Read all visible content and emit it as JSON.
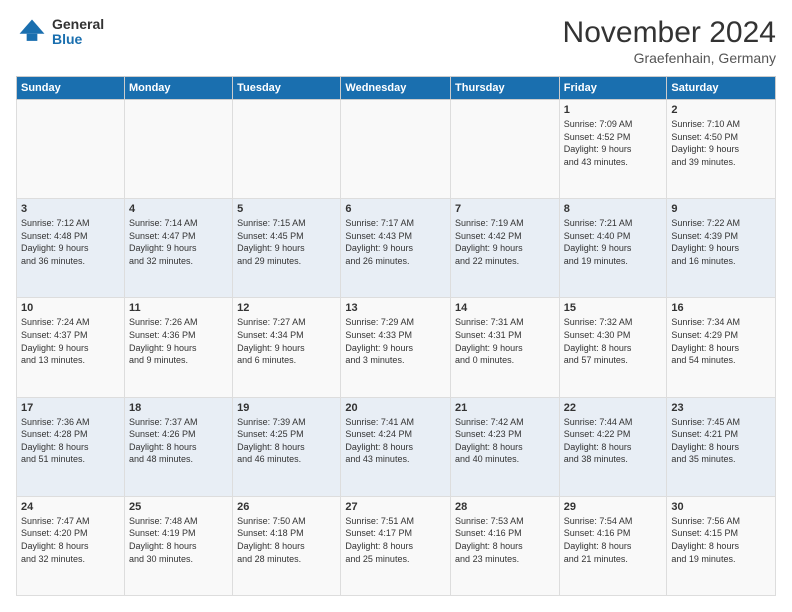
{
  "logo": {
    "general": "General",
    "blue": "Blue"
  },
  "title": "November 2024",
  "location": "Graefenhain, Germany",
  "days_of_week": [
    "Sunday",
    "Monday",
    "Tuesday",
    "Wednesday",
    "Thursday",
    "Friday",
    "Saturday"
  ],
  "weeks": [
    [
      {
        "day": "",
        "info": ""
      },
      {
        "day": "",
        "info": ""
      },
      {
        "day": "",
        "info": ""
      },
      {
        "day": "",
        "info": ""
      },
      {
        "day": "",
        "info": ""
      },
      {
        "day": "1",
        "info": "Sunrise: 7:09 AM\nSunset: 4:52 PM\nDaylight: 9 hours\nand 43 minutes."
      },
      {
        "day": "2",
        "info": "Sunrise: 7:10 AM\nSunset: 4:50 PM\nDaylight: 9 hours\nand 39 minutes."
      }
    ],
    [
      {
        "day": "3",
        "info": "Sunrise: 7:12 AM\nSunset: 4:48 PM\nDaylight: 9 hours\nand 36 minutes."
      },
      {
        "day": "4",
        "info": "Sunrise: 7:14 AM\nSunset: 4:47 PM\nDaylight: 9 hours\nand 32 minutes."
      },
      {
        "day": "5",
        "info": "Sunrise: 7:15 AM\nSunset: 4:45 PM\nDaylight: 9 hours\nand 29 minutes."
      },
      {
        "day": "6",
        "info": "Sunrise: 7:17 AM\nSunset: 4:43 PM\nDaylight: 9 hours\nand 26 minutes."
      },
      {
        "day": "7",
        "info": "Sunrise: 7:19 AM\nSunset: 4:42 PM\nDaylight: 9 hours\nand 22 minutes."
      },
      {
        "day": "8",
        "info": "Sunrise: 7:21 AM\nSunset: 4:40 PM\nDaylight: 9 hours\nand 19 minutes."
      },
      {
        "day": "9",
        "info": "Sunrise: 7:22 AM\nSunset: 4:39 PM\nDaylight: 9 hours\nand 16 minutes."
      }
    ],
    [
      {
        "day": "10",
        "info": "Sunrise: 7:24 AM\nSunset: 4:37 PM\nDaylight: 9 hours\nand 13 minutes."
      },
      {
        "day": "11",
        "info": "Sunrise: 7:26 AM\nSunset: 4:36 PM\nDaylight: 9 hours\nand 9 minutes."
      },
      {
        "day": "12",
        "info": "Sunrise: 7:27 AM\nSunset: 4:34 PM\nDaylight: 9 hours\nand 6 minutes."
      },
      {
        "day": "13",
        "info": "Sunrise: 7:29 AM\nSunset: 4:33 PM\nDaylight: 9 hours\nand 3 minutes."
      },
      {
        "day": "14",
        "info": "Sunrise: 7:31 AM\nSunset: 4:31 PM\nDaylight: 9 hours\nand 0 minutes."
      },
      {
        "day": "15",
        "info": "Sunrise: 7:32 AM\nSunset: 4:30 PM\nDaylight: 8 hours\nand 57 minutes."
      },
      {
        "day": "16",
        "info": "Sunrise: 7:34 AM\nSunset: 4:29 PM\nDaylight: 8 hours\nand 54 minutes."
      }
    ],
    [
      {
        "day": "17",
        "info": "Sunrise: 7:36 AM\nSunset: 4:28 PM\nDaylight: 8 hours\nand 51 minutes."
      },
      {
        "day": "18",
        "info": "Sunrise: 7:37 AM\nSunset: 4:26 PM\nDaylight: 8 hours\nand 48 minutes."
      },
      {
        "day": "19",
        "info": "Sunrise: 7:39 AM\nSunset: 4:25 PM\nDaylight: 8 hours\nand 46 minutes."
      },
      {
        "day": "20",
        "info": "Sunrise: 7:41 AM\nSunset: 4:24 PM\nDaylight: 8 hours\nand 43 minutes."
      },
      {
        "day": "21",
        "info": "Sunrise: 7:42 AM\nSunset: 4:23 PM\nDaylight: 8 hours\nand 40 minutes."
      },
      {
        "day": "22",
        "info": "Sunrise: 7:44 AM\nSunset: 4:22 PM\nDaylight: 8 hours\nand 38 minutes."
      },
      {
        "day": "23",
        "info": "Sunrise: 7:45 AM\nSunset: 4:21 PM\nDaylight: 8 hours\nand 35 minutes."
      }
    ],
    [
      {
        "day": "24",
        "info": "Sunrise: 7:47 AM\nSunset: 4:20 PM\nDaylight: 8 hours\nand 32 minutes."
      },
      {
        "day": "25",
        "info": "Sunrise: 7:48 AM\nSunset: 4:19 PM\nDaylight: 8 hours\nand 30 minutes."
      },
      {
        "day": "26",
        "info": "Sunrise: 7:50 AM\nSunset: 4:18 PM\nDaylight: 8 hours\nand 28 minutes."
      },
      {
        "day": "27",
        "info": "Sunrise: 7:51 AM\nSunset: 4:17 PM\nDaylight: 8 hours\nand 25 minutes."
      },
      {
        "day": "28",
        "info": "Sunrise: 7:53 AM\nSunset: 4:16 PM\nDaylight: 8 hours\nand 23 minutes."
      },
      {
        "day": "29",
        "info": "Sunrise: 7:54 AM\nSunset: 4:16 PM\nDaylight: 8 hours\nand 21 minutes."
      },
      {
        "day": "30",
        "info": "Sunrise: 7:56 AM\nSunset: 4:15 PM\nDaylight: 8 hours\nand 19 minutes."
      }
    ]
  ]
}
